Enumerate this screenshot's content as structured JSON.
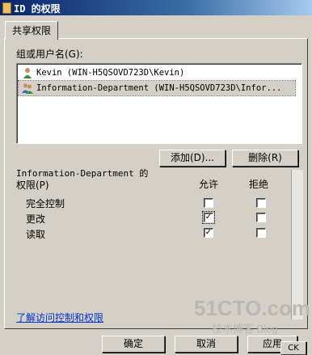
{
  "window": {
    "title": "ID 的权限"
  },
  "tabs": [
    {
      "label": "共享权限"
    }
  ],
  "group_section": {
    "label": "组或用户名(G):"
  },
  "users": [
    {
      "label": "Kevin (WIN-H5QSOVD723D\\Kevin)",
      "icon": "user-icon",
      "selected": false
    },
    {
      "label": "Information-Department (WIN-H5QSOVD723D\\Infor...",
      "icon": "group-icon",
      "selected": true
    }
  ],
  "buttons": {
    "add": "添加(D)...",
    "remove": "删除(R)",
    "ok": "确定",
    "cancel": "取消",
    "apply": "应用",
    "partial": "CK"
  },
  "permissions": {
    "title_line1": "Information-Department 的",
    "title_line2": "权限(P)",
    "allow_header": "允许",
    "deny_header": "拒绝",
    "rows": [
      {
        "name": "完全控制",
        "allow": false,
        "deny": false
      },
      {
        "name": "更改",
        "allow": true,
        "deny": false
      },
      {
        "name": "读取",
        "allow": true,
        "deny": false
      }
    ]
  },
  "link": {
    "text": "了解访问控制和权限"
  },
  "watermark": {
    "main": "51CTO.com",
    "sub": "技术博客  Blog"
  },
  "colors": {
    "titlebar": "#0a246a",
    "face": "#d4d0c8",
    "link": "#0033cc"
  }
}
